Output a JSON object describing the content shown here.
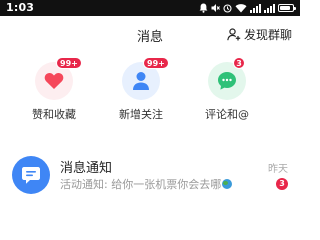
{
  "status_bar": {
    "time": "1:03",
    "battery_level": 0.85,
    "icons": [
      "bell-icon",
      "mute-icon",
      "alarm-icon",
      "wifi-icon",
      "signal-icon",
      "signal-icon",
      "battery-icon"
    ]
  },
  "header": {
    "title": "消息",
    "discover_label": "发现群聊",
    "discover_icon": "person-add-icon"
  },
  "categories": [
    {
      "label": "赞和收藏",
      "badge": "99+",
      "icon": "heart-icon",
      "color": "#f5475a",
      "bg": "#fdeef0"
    },
    {
      "label": "新增关注",
      "badge": "99+",
      "icon": "person-icon",
      "color": "#3f86f5",
      "bg": "#e7f0fe"
    },
    {
      "label": "评论和@",
      "badge": "3",
      "icon": "comment-icon",
      "color": "#2fc178",
      "bg": "#e3f7ec"
    }
  ],
  "notification": {
    "title": "消息通知",
    "preview": "活动通知: 给你一张机票你会去哪",
    "time": "昨天",
    "badge": "3",
    "icon": "message-icon",
    "avatar_color": "#3f86f5"
  },
  "colors": {
    "badge": "#e8274a",
    "status_bar_bg": "#111111"
  }
}
